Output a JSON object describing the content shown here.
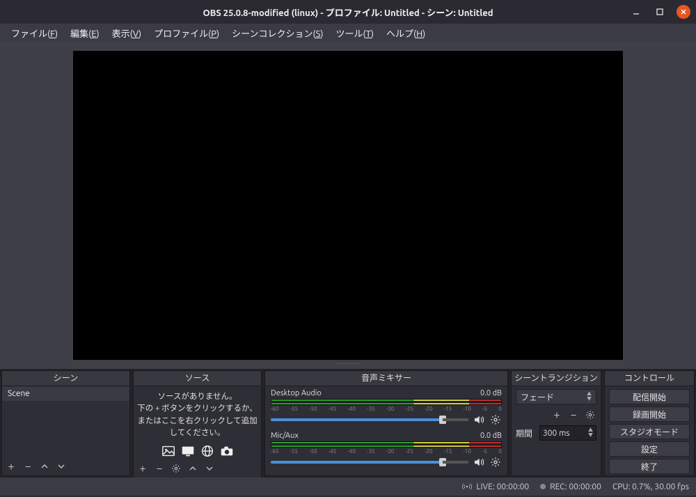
{
  "titlebar": {
    "title": "OBS 25.0.8-modified (linux) - プロファイル: Untitled - シーン: Untitled"
  },
  "menus": {
    "file": {
      "label": "ファイル",
      "hotkey": "F"
    },
    "edit": {
      "label": "編集",
      "hotkey": "E"
    },
    "view": {
      "label": "表示",
      "hotkey": "V"
    },
    "profile": {
      "label": "プロファイル",
      "hotkey": "P"
    },
    "scene_collection": {
      "label": "シーンコレクション",
      "hotkey": "S"
    },
    "tools": {
      "label": "ツール",
      "hotkey": "T"
    },
    "help": {
      "label": "ヘルプ",
      "hotkey": "H"
    }
  },
  "docks": {
    "scenes": {
      "title": "シーン",
      "items": [
        "Scene"
      ]
    },
    "sources": {
      "title": "ソース",
      "empty_line1": "ソースがありません。",
      "empty_line2": "下の + ボタンをクリックするか、",
      "empty_line3": "またはここを右クリックして追加してください。"
    },
    "mixer": {
      "title": "音声ミキサー",
      "channels": [
        {
          "name": "Desktop Audio",
          "db": "0.0 dB"
        },
        {
          "name": "Mic/Aux",
          "db": "0.0 dB"
        }
      ],
      "ticks": [
        "-60",
        "-55",
        "-50",
        "-45",
        "-40",
        "-35",
        "-30",
        "-25",
        "-20",
        "-15",
        "-10",
        "-5",
        "0"
      ]
    },
    "transitions": {
      "title": "シーントランジション",
      "selected": "フェード",
      "duration_label": "期間",
      "duration_value": "300 ms"
    },
    "controls": {
      "title": "コントロール",
      "buttons": {
        "start_stream": "配信開始",
        "start_record": "録画開始",
        "studio_mode": "スタジオモード",
        "settings": "設定",
        "exit": "終了"
      }
    }
  },
  "statusbar": {
    "live": "LIVE: 00:00:00",
    "rec": "REC: 00:00:00",
    "cpu": "CPU: 0.7%, 30.00 fps"
  }
}
